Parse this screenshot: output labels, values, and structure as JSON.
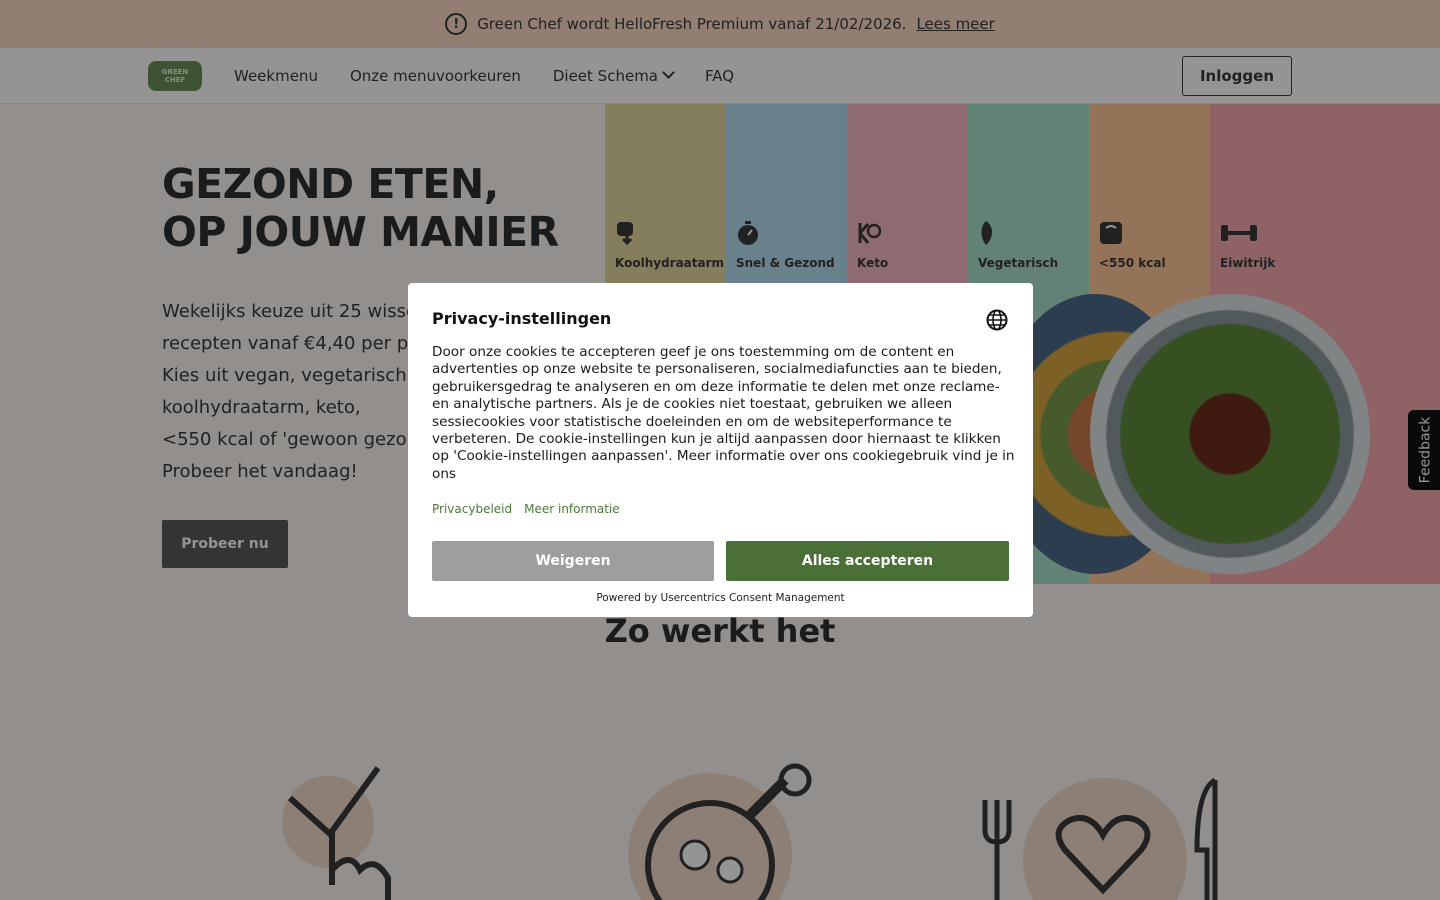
{
  "announcement": {
    "text": "Green Chef wordt HelloFresh Premium vanaf 21/02/2026.",
    "link": "Lees meer"
  },
  "header": {
    "logo_line1": "GREEN",
    "logo_line2": "CHEF",
    "nav": [
      "Weekmenu",
      "Onze menuvoorkeuren",
      "Dieet Schema",
      "FAQ"
    ],
    "login": "Inloggen"
  },
  "hero": {
    "title_line1": "GEZOND ETEN,",
    "title_line2": "OP JOUW MANIER",
    "body": [
      "Wekelijks keuze uit 25 wisselende",
      "recepten vanaf €4,40 per portie.",
      "Kies uit vegan, vegetarisch,",
      "koolhydraatarm, keto,",
      "<550 kcal of 'gewoon gezond'.",
      "Probeer het vandaag!"
    ],
    "cta": "Probeer nu",
    "categories": [
      {
        "label": "Koolhydraatarm",
        "color": "#e6d9a0",
        "icon": "bread-icon"
      },
      {
        "label": "Snel & Gezond",
        "color": "#b6dff2",
        "icon": "stopwatch-icon"
      },
      {
        "label": "Keto",
        "color": "#f4b8c2",
        "icon": "keto-icon"
      },
      {
        "label": "Vegetarisch",
        "color": "#a9e0cc",
        "icon": "leaf-icon"
      },
      {
        "label": "<550 kcal",
        "color": "#ffc89a",
        "icon": "scale-icon"
      },
      {
        "label": "Eiwitrijk",
        "color": "#f6a9ae",
        "icon": "dumbbell-icon"
      }
    ]
  },
  "feedback": "Feedback",
  "how": {
    "title": "Zo werkt het"
  },
  "consent": {
    "title": "Privacy-instellingen",
    "text": "Door onze cookies te accepteren geef je ons toestemming om de content en advertenties op onze website te personaliseren, socialmediafuncties aan te bieden, gebruikersgedrag te analyseren en om deze informatie te delen met onze reclame- en analytische partners. Als je de cookies niet toestaat, gebruiken we alleen sessiecookies voor statistische doeleinden en om de websiteperformance te verbeteren. De cookie-instellingen kun je altijd aanpassen door hiernaast te klikken op 'Cookie-instellingen aanpassen'. Meer informatie over ons cookiegebruik vind je in ons",
    "link_privacy": "Privacybeleid",
    "link_more": "Meer informatie",
    "deny": "Weigeren",
    "accept": "Alles accepteren",
    "powered": "Powered by Usercentrics Consent Management"
  }
}
